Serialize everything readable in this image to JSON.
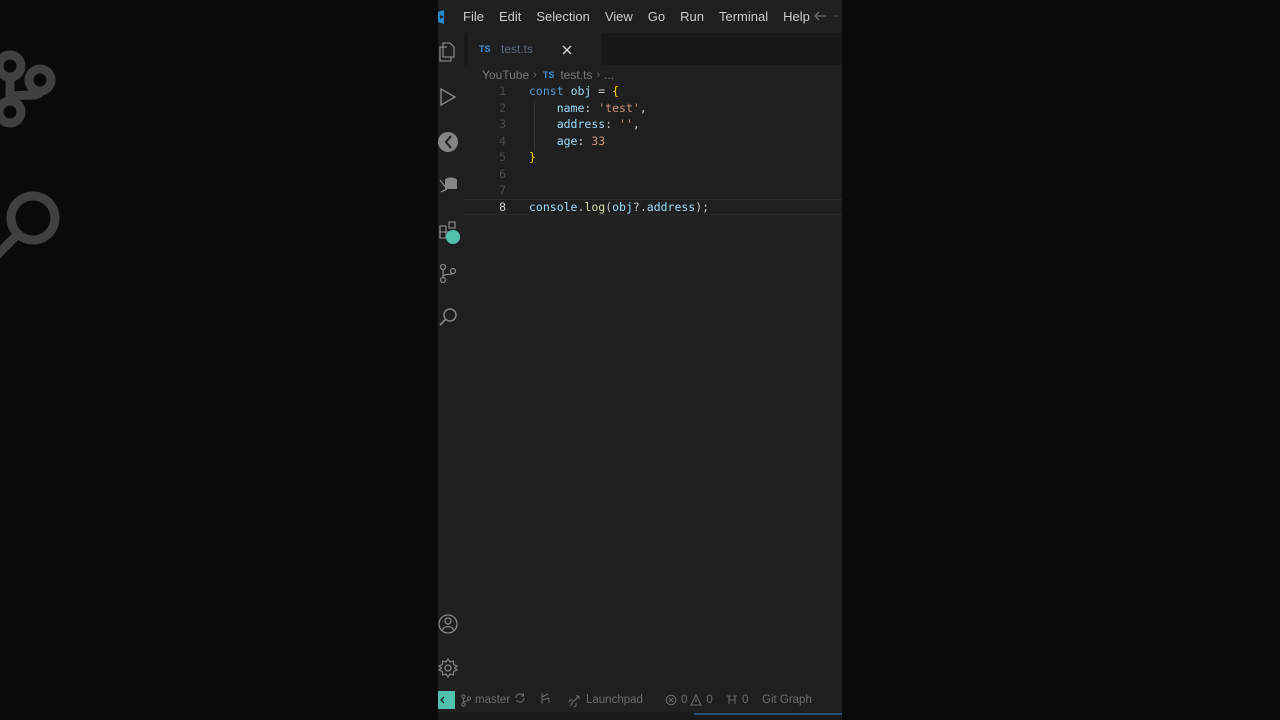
{
  "menu": [
    "File",
    "Edit",
    "Selection",
    "View",
    "Go",
    "Run",
    "Terminal",
    "Help"
  ],
  "tab": {
    "lang_badge": "TS",
    "filename": "test.ts"
  },
  "breadcrumb": {
    "folder": "YouTube",
    "lang_badge": "TS",
    "file": "test.ts",
    "more": "..."
  },
  "editor": {
    "line_numbers": [
      "1",
      "2",
      "3",
      "4",
      "5",
      "6",
      "7",
      "8"
    ],
    "current_line": "8",
    "lines": [
      [
        {
          "t": "const",
          "c": "kw"
        },
        {
          "t": " ",
          "c": "punc"
        },
        {
          "t": "obj",
          "c": "var"
        },
        {
          "t": " = ",
          "c": "punc"
        },
        {
          "t": "{",
          "c": "brace"
        }
      ],
      [
        {
          "t": "    ",
          "c": "punc"
        },
        {
          "t": "name",
          "c": "prop"
        },
        {
          "t": ": ",
          "c": "punc"
        },
        {
          "t": "'test'",
          "c": "str"
        },
        {
          "t": ",",
          "c": "punc"
        }
      ],
      [
        {
          "t": "    ",
          "c": "punc"
        },
        {
          "t": "address",
          "c": "prop"
        },
        {
          "t": ": ",
          "c": "punc"
        },
        {
          "t": "''",
          "c": "str"
        },
        {
          "t": ",",
          "c": "punc"
        }
      ],
      [
        {
          "t": "    ",
          "c": "punc"
        },
        {
          "t": "age",
          "c": "prop"
        },
        {
          "t": ": ",
          "c": "punc"
        },
        {
          "t": "33",
          "c": "str"
        }
      ],
      [
        {
          "t": "}",
          "c": "brace"
        }
      ],
      [],
      [],
      [
        {
          "t": "console",
          "c": "var"
        },
        {
          "t": ".",
          "c": "punc"
        },
        {
          "t": "log",
          "c": "fn"
        },
        {
          "t": "(",
          "c": "punc"
        },
        {
          "t": "obj",
          "c": "var"
        },
        {
          "t": "?.",
          "c": "punc"
        },
        {
          "t": "address",
          "c": "prop"
        },
        {
          "t": ");",
          "c": "punc"
        }
      ]
    ]
  },
  "statusbar": {
    "branch": "master",
    "launchpad": "Launchpad",
    "errors": "0",
    "warnings": "0",
    "ports": "0",
    "git_graph": "Git Graph"
  },
  "colors": {
    "accent": "#4ec2ac",
    "keyword": "#569cd6",
    "string": "#ce9178",
    "brace": "#ffd700"
  },
  "icons": [
    "vscode-logo-icon",
    "files-icon",
    "run-debug-icon",
    "gitlens-icon",
    "database-icon",
    "extensions-icon",
    "source-control-icon",
    "search-icon",
    "account-icon",
    "settings-gear-icon",
    "close-icon",
    "arrow-left-icon",
    "remote-icon",
    "git-branch-icon",
    "sync-icon",
    "graph-icon",
    "rocket-icon",
    "error-icon",
    "warning-icon",
    "ports-icon"
  ]
}
